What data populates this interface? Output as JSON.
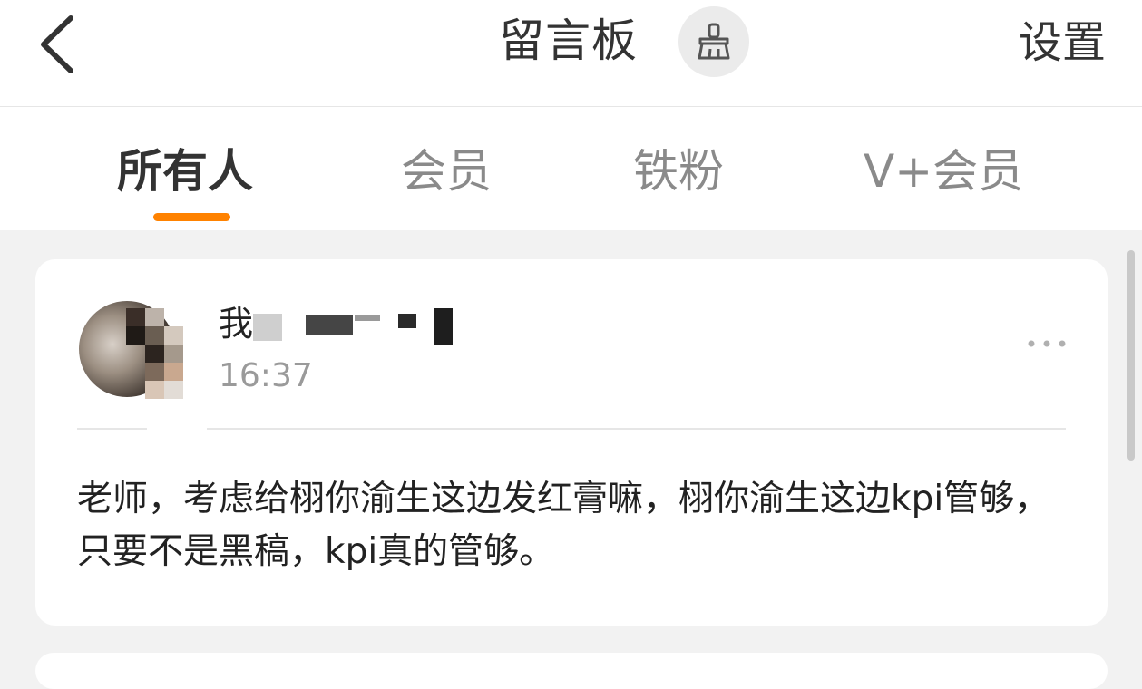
{
  "header": {
    "title": "留言板",
    "settings_label": "设置",
    "back_icon": "chevron-left-icon",
    "clean_icon": "brush-icon"
  },
  "tabs": [
    {
      "label": "所有人",
      "active": true
    },
    {
      "label": "会员",
      "active": false
    },
    {
      "label": "铁粉",
      "active": false
    },
    {
      "label": "V+会员",
      "active": false
    }
  ],
  "colors": {
    "accent": "#ff8200",
    "text_primary": "#333333",
    "text_secondary": "#8a8a8a",
    "page_background": "#f2f2f2"
  },
  "messages": [
    {
      "username": "我",
      "time": "16:37",
      "more_icon": "more-horizontal-icon",
      "content": "老师，考虑给栩你渝生这边发红膏嘛，栩你渝生这边kpi管够，只要不是黑稿，kpi真的管够。"
    }
  ]
}
